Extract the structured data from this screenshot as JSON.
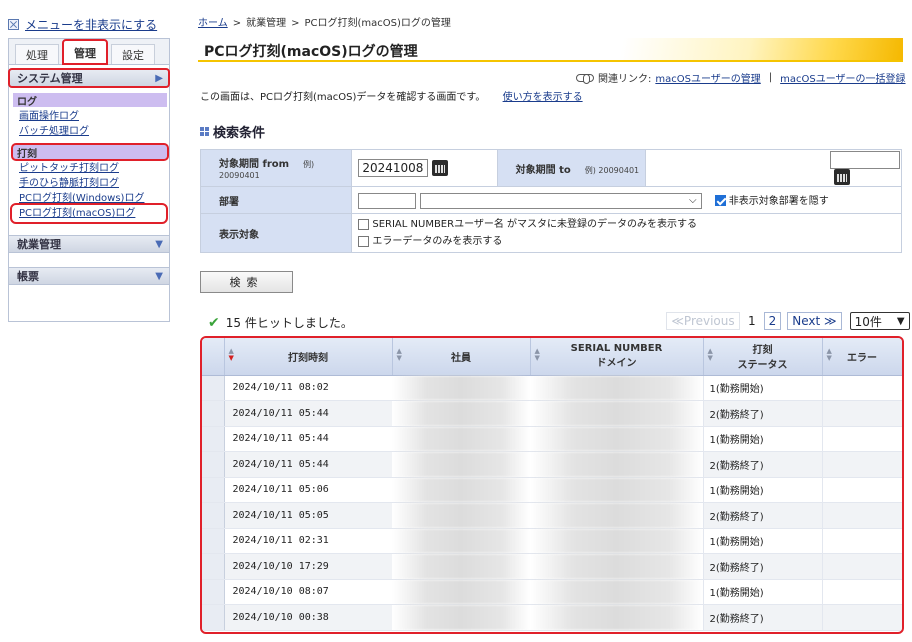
{
  "sidebar": {
    "hide_menu": "メニューを非表示にする",
    "tabs": [
      "処理",
      "管理",
      "設定"
    ],
    "system_admin": "システム管理",
    "log_header": "ログ",
    "log_links": [
      "画面操作ログ",
      "バッチ処理ログ"
    ],
    "stamp_header": "打刻",
    "stamp_links": [
      "ピットタッチ打刻ログ",
      "手のひら静脈打刻ログ",
      "PCログ打刻(Windows)ログ",
      "PCログ打刻(macOS)ログ"
    ],
    "work_admin": "就業管理",
    "reports": "帳票"
  },
  "breadcrumb": [
    "ホーム",
    "就業管理",
    "PCログ打刻(macOS)ログの管理"
  ],
  "page_title": "PCログ打刻(macOS)ログの管理",
  "related": {
    "label": "関連リンク:",
    "link1": "macOSユーザーの管理",
    "sep": "|",
    "link2": "macOSユーザーの一括登録"
  },
  "intro": {
    "text": "この画面は、PCログ打刻(macOS)データを確認する画面です。",
    "help_link": "使い方を表示する"
  },
  "search": {
    "heading": "検索条件",
    "from_label": "対象期間 from",
    "from_example": "例) 20090401",
    "from_value": "20241008",
    "to_label": "対象期間 to",
    "to_example": "例) 20090401",
    "to_value": "",
    "dept_label": "部署",
    "hide_dept_label": "非表示対象部署を隠す",
    "display_label": "表示対象",
    "opt1": "SERIAL NUMBERユーザー名 がマスタに未登録のデータのみを表示する",
    "opt2": "エラーデータのみを表示する",
    "button": "検索"
  },
  "results": {
    "message": "15 件ヒットしました。",
    "prev": "≪Previous",
    "page1": "1",
    "page2": "2",
    "next": "Next ≫",
    "per_page": "10件"
  },
  "grid": {
    "headers": {
      "time": "打刻時刻",
      "employee": "社員",
      "serial_line1": "SERIAL NUMBER",
      "serial_line2": "ドメイン",
      "status_line1": "打刻",
      "status_line2": "ステータス",
      "error": "エラー"
    },
    "rows": [
      {
        "time": "2024/10/11 08:02",
        "status": "1(勤務開始)"
      },
      {
        "time": "2024/10/11 05:44",
        "status": "2(勤務終了)"
      },
      {
        "time": "2024/10/11 05:44",
        "status": "1(勤務開始)"
      },
      {
        "time": "2024/10/11 05:44",
        "status": "2(勤務終了)"
      },
      {
        "time": "2024/10/11 05:06",
        "status": "1(勤務開始)"
      },
      {
        "time": "2024/10/11 05:05",
        "status": "2(勤務終了)"
      },
      {
        "time": "2024/10/11 02:31",
        "status": "1(勤務開始)"
      },
      {
        "time": "2024/10/10 17:29",
        "status": "2(勤務終了)"
      },
      {
        "time": "2024/10/10 08:07",
        "status": "1(勤務開始)"
      },
      {
        "time": "2024/10/10 00:38",
        "status": "2(勤務終了)"
      }
    ]
  },
  "colors": {
    "highlight": "#e0202a",
    "accent": "#f5c400",
    "header_bg": "#d6e0f3",
    "sub_header_bg": "#cdbdf0"
  }
}
